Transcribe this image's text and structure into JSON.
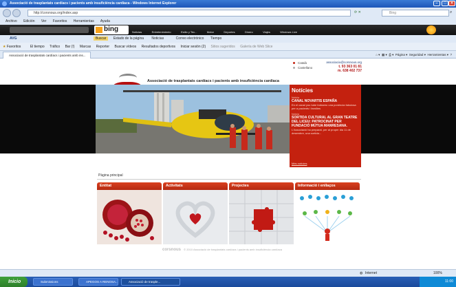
{
  "window": {
    "title": "Associació de trasplantats cardíacs i pacients amb insuficiència cardíaca - Windows Internet Explorer"
  },
  "address": {
    "url": "http://corsnous.org/index.asp",
    "search_placeholder": "Bing"
  },
  "menu": [
    "Archivo",
    "Edición",
    "Ver",
    "Favoritos",
    "Herramientas",
    "Ayuda"
  ],
  "bing_bar": {
    "logo": "bing",
    "links": [
      "Noticias",
      "Entretenimiento",
      "Estilo y Tec...",
      "Motor",
      "Deportes",
      "Dinero",
      "Viajes",
      "Windows Live"
    ]
  },
  "links_bar": {
    "avg": "AVG",
    "items": [
      "Buscar",
      "Estado de la página",
      "Noticias",
      "Correo electrónico",
      "Tiempo"
    ]
  },
  "favorites_bar": {
    "label": "Favoritos",
    "items": [
      "El tiempo",
      "Tráfico",
      "Bar (!)",
      "Marcas",
      "Reporter",
      "Buscar vídeos",
      "Resultados deportivos",
      "Iniciar sesión (2)",
      "Sitios sugeridos",
      "Galería de Web Slice"
    ]
  },
  "tab": {
    "label": "Associació de trasplantats cardíacs i pacients amb ins...",
    "tools": [
      "Página",
      "Seguridad",
      "Herramientas"
    ]
  },
  "site": {
    "logo_text": "corsnous",
    "title": "Associació de trasplantats cardíacs i pacients amb insuficiència cardíaca",
    "languages": [
      {
        "label": "Català",
        "color": "#c4210f"
      },
      {
        "label": "Castellano",
        "color": "#aaaaaa"
      }
    ],
    "contact": {
      "email": "associacio@corsnous.org",
      "phone": "t. 93 363 01 81",
      "mobile": "m. 638 402 737"
    },
    "news": {
      "heading": "Notícies",
      "items": [
        {
          "label": "Notícia",
          "title": "CANAL NOVARTIS ESPAÑA",
          "desc": "En el canal you tube trobareu una ponència fabulosa per a pacients i famílies"
        },
        {
          "label": "Notícia",
          "title": "SORTIDA CULTURAL AL GRAN TEATRE DEL LICEU: PATROCINAT PER FUNDACIÓ MÚTUA MANRESANA.",
          "desc": "L'Associació ha preparat, per al proper dia 11 de desembre, una sortida..."
        }
      ],
      "more": "Més notícies"
    },
    "breadcrumb": "Pàgina principal",
    "sections": [
      "Entitat",
      "Activitats",
      "Projectes",
      "Informació i enllaços"
    ],
    "footer": {
      "logo": "corsnous",
      "text": "© 2010 Associació de trasplantats cardíacs i pacients amb insuficiència cardíaca"
    }
  },
  "statusbar": {
    "zone": "Internet",
    "zoom": "100%"
  },
  "taskbar": {
    "start": "Inicio",
    "tasks": [
      "Submissions",
      "APEGOS A RENOSA...",
      "Associació de trasple..."
    ],
    "clock": "11:00"
  },
  "colors": {
    "brand_red": "#c4210f",
    "ie_blue": "#1d56b8",
    "taskbar_blue": "#2a5fb5"
  }
}
